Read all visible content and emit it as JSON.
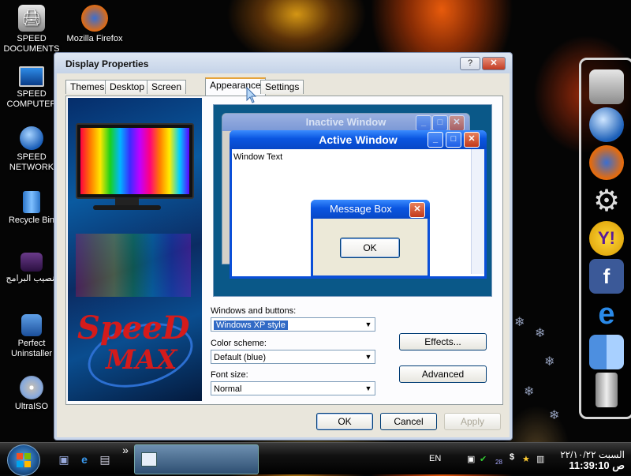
{
  "desktop_icons": [
    {
      "label": "SPEED DOCUMENTS",
      "icon": "printer-icon"
    },
    {
      "label": "Mozilla Firefox",
      "icon": "firefox-icon"
    },
    {
      "label": "SPEED COMPUTER",
      "icon": "monitor-icon"
    },
    {
      "label": "SPEED NETWORK",
      "icon": "globe-icon"
    },
    {
      "label": "Recycle Bin",
      "icon": "recycle-bin-icon"
    },
    {
      "label": "تنصيب البرامج",
      "icon": "film-folder-icon"
    },
    {
      "label": "Perfect Uninstaller",
      "icon": "uninstaller-icon"
    },
    {
      "label": "UltraISO",
      "icon": "disc-icon"
    }
  ],
  "dialog": {
    "title": "Display Properties",
    "help_label": "?",
    "close_label": "✕",
    "tabs": [
      {
        "label": "Themes"
      },
      {
        "label": "Desktop"
      },
      {
        "label": "Screen Saver"
      },
      {
        "label": "Appearance"
      },
      {
        "label": "Settings"
      }
    ],
    "active_tab": "Appearance",
    "logo_text_1": "SpeeD",
    "logo_text_2": "MAX",
    "preview": {
      "inactive_title": "Inactive Window",
      "active_title": "Active Window",
      "window_text": "Window Text",
      "msgbox_title": "Message Box",
      "msgbox_ok": "OK"
    },
    "windows_buttons_label": "Windows and buttons:",
    "windows_buttons_value": "Windows XP style",
    "color_scheme_label": "Color scheme:",
    "color_scheme_value": "Default (blue)",
    "font_size_label": "Font size:",
    "font_size_value": "Normal",
    "effects_label": "Effects...",
    "advanced_label": "Advanced",
    "ok_label": "OK",
    "cancel_label": "Cancel",
    "apply_label": "Apply"
  },
  "dock_items": [
    {
      "icon": "computer-icon"
    },
    {
      "icon": "globe-icon"
    },
    {
      "icon": "firefox-icon"
    },
    {
      "icon": "gear-icon"
    },
    {
      "icon": "yahoo-messenger-icon"
    },
    {
      "icon": "facebook-icon",
      "text": "f"
    },
    {
      "icon": "internet-explorer-icon",
      "text": "e"
    },
    {
      "icon": "finder-icon"
    },
    {
      "icon": "trash-icon"
    }
  ],
  "taskbar": {
    "language": "EN",
    "tray_number": "28",
    "clock_date": "السبت ٢٢/١٠/٢٢",
    "clock_time": "11:39:10 ص",
    "quicklaunch_more": "»"
  },
  "colors": {
    "xp_blue": "#0a55e0",
    "selection": "#316ac5",
    "tab_highlight": "#e6a43b"
  }
}
